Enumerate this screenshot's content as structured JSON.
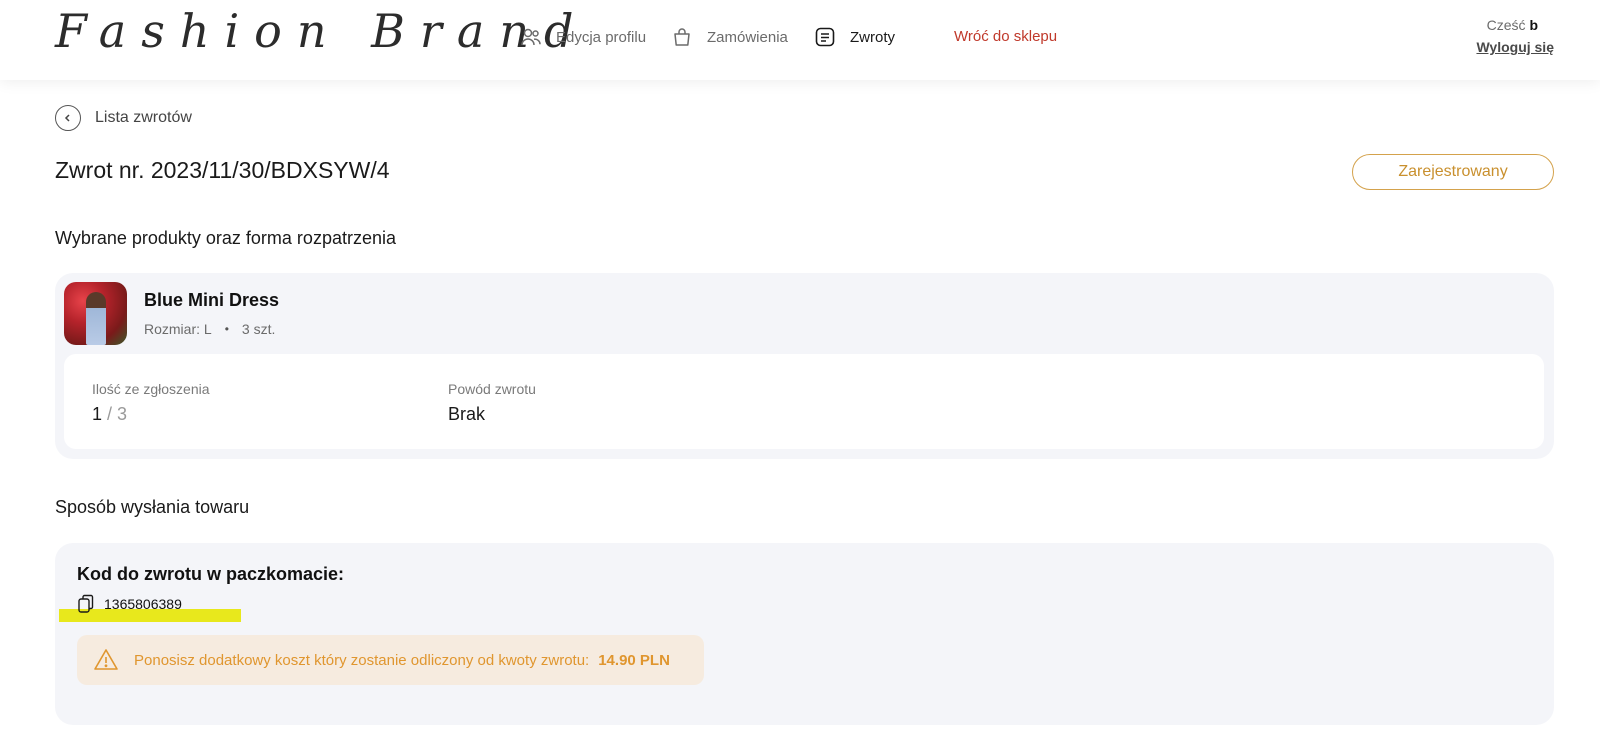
{
  "header": {
    "logo": "Fashion Brand",
    "nav": [
      {
        "label": "Edycja profilu",
        "icon": "users-icon"
      },
      {
        "label": "Zamówienia",
        "icon": "shopping-bag-icon"
      },
      {
        "label": "Zwroty",
        "icon": "returns-list-icon"
      }
    ],
    "back_to_shop": "Wróć do sklepu",
    "greeting": "Cześć",
    "username": "b",
    "logout": "Wyloguj się"
  },
  "breadcrumb": {
    "back_label": "Lista zwrotów"
  },
  "page": {
    "title": "Zwrot nr. 2023/11/30/BDXSYW/4",
    "status": "Zarejestrowany"
  },
  "products_section": {
    "title": "Wybrane produkty oraz forma rozpatrzenia",
    "product": {
      "name": "Blue Mini Dress",
      "size": "Rozmiar: L",
      "dot": "•",
      "quantity": "3 szt.",
      "qty_label": "Ilość ze zgłoszenia",
      "qty_selected": "1",
      "qty_total": " / 3",
      "reason_label": "Powód zwrotu",
      "reason_value": "Brak"
    }
  },
  "shipping_section": {
    "title": "Sposób wysłania towaru",
    "card_title": "Kod do zwrotu w paczkomacie:",
    "code": "1365806389",
    "alert_text": "Ponosisz dodatkowy koszt który zostanie odliczony od kwoty zwrotu:",
    "alert_amount": "14.90 PLN"
  },
  "colors": {
    "accent_red": "#c0392b",
    "status_gold": "#c9902e",
    "alert_orange": "#e0962f",
    "highlight_yellow": "#e8e81c"
  }
}
